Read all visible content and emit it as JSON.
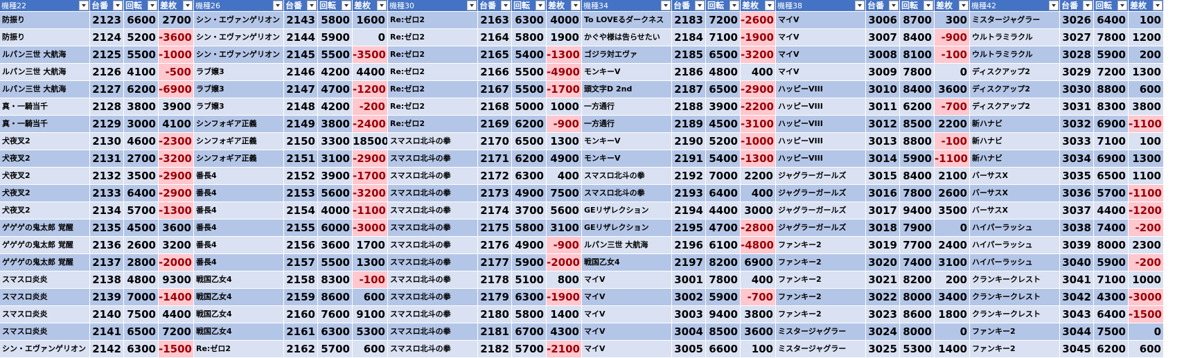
{
  "columns": [
    {
      "name": "機種22",
      "dai": "台番",
      "kai": "回転",
      "sa": "差枚"
    },
    {
      "name": "機種26",
      "dai": "台番",
      "kai": "回転",
      "sa": "差枚"
    },
    {
      "name": "機種30",
      "dai": "台番",
      "kai": "回転",
      "sa": "差枚"
    },
    {
      "name": "機種34",
      "dai": "台番",
      "kai": "回転",
      "sa": "差枚"
    },
    {
      "name": "機種38",
      "dai": "台番",
      "kai": "回転",
      "sa": "差枚"
    },
    {
      "name": "機種42",
      "dai": "台番",
      "kai": "回転",
      "sa": "差枚"
    }
  ],
  "blocks": [
    [
      {
        "name": "防振り",
        "dai": "2123",
        "kai": "6600",
        "sa": "2700"
      },
      {
        "name": "防振り",
        "dai": "2124",
        "kai": "5200",
        "sa": "-3600"
      },
      {
        "name": "ルパン三世 大航海",
        "dai": "2125",
        "kai": "5500",
        "sa": "-1000"
      },
      {
        "name": "ルパン三世 大航海",
        "dai": "2126",
        "kai": "4100",
        "sa": "-500"
      },
      {
        "name": "ルパン三世 大航海",
        "dai": "2127",
        "kai": "6200",
        "sa": "-6900"
      },
      {
        "name": "真・一騎当千",
        "dai": "2128",
        "kai": "3800",
        "sa": "3900"
      },
      {
        "name": "真・一騎当千",
        "dai": "2129",
        "kai": "3000",
        "sa": "4100"
      },
      {
        "name": "犬夜叉2",
        "dai": "2130",
        "kai": "4600",
        "sa": "-2300"
      },
      {
        "name": "犬夜叉2",
        "dai": "2131",
        "kai": "2700",
        "sa": "-3200"
      },
      {
        "name": "犬夜叉2",
        "dai": "2132",
        "kai": "3500",
        "sa": "-2900"
      },
      {
        "name": "犬夜叉2",
        "dai": "2133",
        "kai": "6400",
        "sa": "-2900"
      },
      {
        "name": "犬夜叉2",
        "dai": "2134",
        "kai": "5700",
        "sa": "-1300"
      },
      {
        "name": "ゲゲゲの鬼太郎 覚醒",
        "dai": "2135",
        "kai": "4500",
        "sa": "3600"
      },
      {
        "name": "ゲゲゲの鬼太郎 覚醒",
        "dai": "2136",
        "kai": "2600",
        "sa": "3200"
      },
      {
        "name": "ゲゲゲの鬼太郎 覚醒",
        "dai": "2137",
        "kai": "2800",
        "sa": "-2000"
      },
      {
        "name": "スマスロ炎炎",
        "dai": "2138",
        "kai": "4800",
        "sa": "9300"
      },
      {
        "name": "スマスロ炎炎",
        "dai": "2139",
        "kai": "7000",
        "sa": "-1400"
      },
      {
        "name": "スマスロ炎炎",
        "dai": "2140",
        "kai": "7500",
        "sa": "4400"
      },
      {
        "name": "スマスロ炎炎",
        "dai": "2141",
        "kai": "6500",
        "sa": "7200"
      },
      {
        "name": "シン・エヴァンゲリオン",
        "dai": "2142",
        "kai": "6300",
        "sa": "-1500"
      }
    ],
    [
      {
        "name": "シン・エヴァンゲリオン",
        "dai": "2143",
        "kai": "5800",
        "sa": "1600"
      },
      {
        "name": "シン・エヴァンゲリオン",
        "dai": "2144",
        "kai": "5900",
        "sa": "0"
      },
      {
        "name": "シン・エヴァンゲリオン",
        "dai": "2145",
        "kai": "5500",
        "sa": "-3500"
      },
      {
        "name": "ラブ嬢3",
        "dai": "2146",
        "kai": "4200",
        "sa": "4400"
      },
      {
        "name": "ラブ嬢3",
        "dai": "2147",
        "kai": "4700",
        "sa": "-1200"
      },
      {
        "name": "ラブ嬢3",
        "dai": "2148",
        "kai": "4200",
        "sa": "-200"
      },
      {
        "name": "シンフォギア正義",
        "dai": "2149",
        "kai": "3800",
        "sa": "-2400"
      },
      {
        "name": "シンフォギア正義",
        "dai": "2150",
        "kai": "3300",
        "sa": "18500"
      },
      {
        "name": "シンフォギア正義",
        "dai": "2151",
        "kai": "3100",
        "sa": "-2900"
      },
      {
        "name": "番長4",
        "dai": "2152",
        "kai": "3900",
        "sa": "-1700"
      },
      {
        "name": "番長4",
        "dai": "2153",
        "kai": "5600",
        "sa": "-3200"
      },
      {
        "name": "番長4",
        "dai": "2154",
        "kai": "4000",
        "sa": "-1100"
      },
      {
        "name": "番長4",
        "dai": "2155",
        "kai": "6000",
        "sa": "-3000"
      },
      {
        "name": "番長4",
        "dai": "2156",
        "kai": "3600",
        "sa": "1700"
      },
      {
        "name": "番長4",
        "dai": "2157",
        "kai": "5500",
        "sa": "1300"
      },
      {
        "name": "戦国乙女4",
        "dai": "2158",
        "kai": "8300",
        "sa": "-100"
      },
      {
        "name": "戦国乙女4",
        "dai": "2159",
        "kai": "8600",
        "sa": "600"
      },
      {
        "name": "戦国乙女4",
        "dai": "2160",
        "kai": "7600",
        "sa": "9100"
      },
      {
        "name": "戦国乙女4",
        "dai": "2161",
        "kai": "6300",
        "sa": "5300"
      },
      {
        "name": "Re:ゼロ2",
        "dai": "2162",
        "kai": "5700",
        "sa": "600"
      }
    ],
    [
      {
        "name": "Re:ゼロ2",
        "dai": "2163",
        "kai": "6300",
        "sa": "4000"
      },
      {
        "name": "Re:ゼロ2",
        "dai": "2164",
        "kai": "5800",
        "sa": "1900"
      },
      {
        "name": "Re:ゼロ2",
        "dai": "2165",
        "kai": "5400",
        "sa": "-1300"
      },
      {
        "name": "Re:ゼロ2",
        "dai": "2166",
        "kai": "5500",
        "sa": "-4900"
      },
      {
        "name": "Re:ゼロ2",
        "dai": "2167",
        "kai": "5500",
        "sa": "-1700"
      },
      {
        "name": "Re:ゼロ2",
        "dai": "2168",
        "kai": "5000",
        "sa": "1000"
      },
      {
        "name": "Re:ゼロ2",
        "dai": "2169",
        "kai": "6200",
        "sa": "-900"
      },
      {
        "name": "スマスロ北斗の拳",
        "dai": "2170",
        "kai": "6500",
        "sa": "1300"
      },
      {
        "name": "スマスロ北斗の拳",
        "dai": "2171",
        "kai": "6200",
        "sa": "4900"
      },
      {
        "name": "スマスロ北斗の拳",
        "dai": "2172",
        "kai": "6300",
        "sa": "400"
      },
      {
        "name": "スマスロ北斗の拳",
        "dai": "2173",
        "kai": "4900",
        "sa": "7500"
      },
      {
        "name": "スマスロ北斗の拳",
        "dai": "2174",
        "kai": "3700",
        "sa": "5600"
      },
      {
        "name": "スマスロ北斗の拳",
        "dai": "2175",
        "kai": "5800",
        "sa": "3100"
      },
      {
        "name": "スマスロ北斗の拳",
        "dai": "2176",
        "kai": "4900",
        "sa": "-900"
      },
      {
        "name": "スマスロ北斗の拳",
        "dai": "2177",
        "kai": "5900",
        "sa": "-2000"
      },
      {
        "name": "スマスロ北斗の拳",
        "dai": "2178",
        "kai": "5100",
        "sa": "800"
      },
      {
        "name": "スマスロ北斗の拳",
        "dai": "2179",
        "kai": "6300",
        "sa": "-1900"
      },
      {
        "name": "スマスロ北斗の拳",
        "dai": "2180",
        "kai": "5800",
        "sa": "1400"
      },
      {
        "name": "スマスロ北斗の拳",
        "dai": "2181",
        "kai": "6700",
        "sa": "4300"
      },
      {
        "name": "スマスロ北斗の拳",
        "dai": "2182",
        "kai": "5700",
        "sa": "-2100"
      }
    ],
    [
      {
        "name": "To LOVEるダークネス",
        "dai": "2183",
        "kai": "7200",
        "sa": "-2600"
      },
      {
        "name": "かぐや様は告らせたい",
        "dai": "2184",
        "kai": "7100",
        "sa": "-1900"
      },
      {
        "name": "ゴジラ対エヴァ",
        "dai": "2185",
        "kai": "6500",
        "sa": "-3200"
      },
      {
        "name": "モンキーV",
        "dai": "2186",
        "kai": "4800",
        "sa": "400"
      },
      {
        "name": "頭文字D 2nd",
        "dai": "2187",
        "kai": "6500",
        "sa": "-2900"
      },
      {
        "name": "一方通行",
        "dai": "2188",
        "kai": "3900",
        "sa": "-2200"
      },
      {
        "name": "一方通行",
        "dai": "2189",
        "kai": "4500",
        "sa": "-3100"
      },
      {
        "name": "モンキーV",
        "dai": "2190",
        "kai": "5200",
        "sa": "-1000"
      },
      {
        "name": "モンキーV",
        "dai": "2191",
        "kai": "5400",
        "sa": "-1300"
      },
      {
        "name": "スマスロ北斗の拳",
        "dai": "2192",
        "kai": "7000",
        "sa": "2200"
      },
      {
        "name": "スマスロ北斗の拳",
        "dai": "2193",
        "kai": "6400",
        "sa": "400"
      },
      {
        "name": "GEリザレクション",
        "dai": "2194",
        "kai": "4400",
        "sa": "3000"
      },
      {
        "name": "GEリザレクション",
        "dai": "2195",
        "kai": "4700",
        "sa": "-2800"
      },
      {
        "name": "ルパン三世 大航海",
        "dai": "2196",
        "kai": "6100",
        "sa": "-4800"
      },
      {
        "name": "戦国乙女4",
        "dai": "2197",
        "kai": "8200",
        "sa": "6900"
      },
      {
        "name": "マイV",
        "dai": "3001",
        "kai": "7800",
        "sa": "400"
      },
      {
        "name": "マイV",
        "dai": "3002",
        "kai": "5900",
        "sa": "-700"
      },
      {
        "name": "マイV",
        "dai": "3003",
        "kai": "9400",
        "sa": "3800"
      },
      {
        "name": "マイV",
        "dai": "3004",
        "kai": "8500",
        "sa": "3600"
      },
      {
        "name": "マイV",
        "dai": "3005",
        "kai": "6600",
        "sa": "100"
      }
    ],
    [
      {
        "name": "マイV",
        "dai": "3006",
        "kai": "8700",
        "sa": "300"
      },
      {
        "name": "マイV",
        "dai": "3007",
        "kai": "8400",
        "sa": "-900"
      },
      {
        "name": "マイV",
        "dai": "3008",
        "kai": "8100",
        "sa": "-100"
      },
      {
        "name": "マイV",
        "dai": "3009",
        "kai": "7800",
        "sa": "0"
      },
      {
        "name": "ハッピーVIII",
        "dai": "3010",
        "kai": "8400",
        "sa": "3600"
      },
      {
        "name": "ハッピーVIII",
        "dai": "3011",
        "kai": "6200",
        "sa": "-700"
      },
      {
        "name": "ハッピーVIII",
        "dai": "3012",
        "kai": "8500",
        "sa": "2200"
      },
      {
        "name": "ハッピーVIII",
        "dai": "3013",
        "kai": "8800",
        "sa": "-100"
      },
      {
        "name": "ハッピーVIII",
        "dai": "3014",
        "kai": "5900",
        "sa": "-1100"
      },
      {
        "name": "ジャグラーガールズ",
        "dai": "3015",
        "kai": "8400",
        "sa": "2100"
      },
      {
        "name": "ジャグラーガールズ",
        "dai": "3016",
        "kai": "7800",
        "sa": "2600"
      },
      {
        "name": "ジャグラーガールズ",
        "dai": "3017",
        "kai": "9400",
        "sa": "3500"
      },
      {
        "name": "ジャグラーガールズ",
        "dai": "3018",
        "kai": "7900",
        "sa": "0"
      },
      {
        "name": "ファンキー2",
        "dai": "3019",
        "kai": "7700",
        "sa": "2400"
      },
      {
        "name": "ファンキー2",
        "dai": "3020",
        "kai": "7400",
        "sa": "3100"
      },
      {
        "name": "ファンキー2",
        "dai": "3021",
        "kai": "8200",
        "sa": "200"
      },
      {
        "name": "ファンキー2",
        "dai": "3022",
        "kai": "8000",
        "sa": "3400"
      },
      {
        "name": "ファンキー2",
        "dai": "3023",
        "kai": "8600",
        "sa": "1800"
      },
      {
        "name": "ミスタージャグラー",
        "dai": "3024",
        "kai": "8000",
        "sa": "0"
      },
      {
        "name": "ミスタージャグラー",
        "dai": "3025",
        "kai": "5300",
        "sa": "1400"
      }
    ],
    [
      {
        "name": "ミスタージャグラー",
        "dai": "3026",
        "kai": "6400",
        "sa": "100"
      },
      {
        "name": "ウルトラミラクル",
        "dai": "3027",
        "kai": "7800",
        "sa": "1200"
      },
      {
        "name": "ウルトラミラクル",
        "dai": "3028",
        "kai": "5900",
        "sa": "200"
      },
      {
        "name": "ディスクアップ2",
        "dai": "3029",
        "kai": "7200",
        "sa": "1300"
      },
      {
        "name": "ディスクアップ2",
        "dai": "3030",
        "kai": "8800",
        "sa": "600"
      },
      {
        "name": "ディスクアップ2",
        "dai": "3031",
        "kai": "8300",
        "sa": "3800"
      },
      {
        "name": "新ハナビ",
        "dai": "3032",
        "kai": "6900",
        "sa": "-1100"
      },
      {
        "name": "新ハナビ",
        "dai": "3033",
        "kai": "7100",
        "sa": "100"
      },
      {
        "name": "新ハナビ",
        "dai": "3034",
        "kai": "6900",
        "sa": "1300"
      },
      {
        "name": "バーサスX",
        "dai": "3035",
        "kai": "6500",
        "sa": "1100"
      },
      {
        "name": "バーサスX",
        "dai": "3036",
        "kai": "5700",
        "sa": "-1100"
      },
      {
        "name": "バーサスX",
        "dai": "3037",
        "kai": "4400",
        "sa": "-1200"
      },
      {
        "name": "ハイパーラッシュ",
        "dai": "3038",
        "kai": "7400",
        "sa": "-200"
      },
      {
        "name": "ハイパーラッシュ",
        "dai": "3039",
        "kai": "8000",
        "sa": "2300"
      },
      {
        "name": "ハイパーラッシュ",
        "dai": "3040",
        "kai": "5900",
        "sa": "-200"
      },
      {
        "name": "クランキークレスト",
        "dai": "3041",
        "kai": "7100",
        "sa": "1000"
      },
      {
        "name": "クランキークレスト",
        "dai": "3042",
        "kai": "4300",
        "sa": "-3000"
      },
      {
        "name": "クランキークレスト",
        "dai": "3043",
        "kai": "6400",
        "sa": "-1500"
      },
      {
        "name": "ファンキー2",
        "dai": "3044",
        "kai": "7500",
        "sa": "0"
      },
      {
        "name": "ファンキー2",
        "dai": "3045",
        "kai": "6200",
        "sa": "600"
      }
    ]
  ]
}
